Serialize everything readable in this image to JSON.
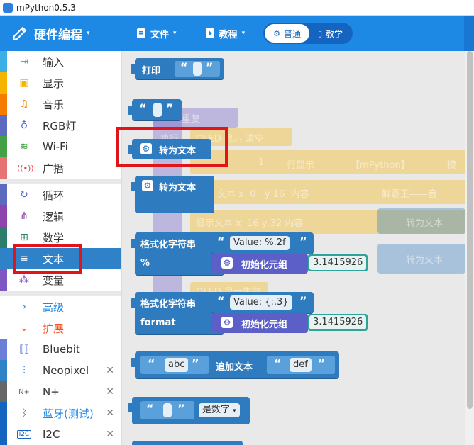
{
  "window": {
    "title": "mPython0.5.3"
  },
  "header": {
    "brand": "硬件编程",
    "menus": [
      {
        "label": "文件"
      },
      {
        "label": "教程"
      }
    ],
    "modes": [
      {
        "label": "普通",
        "active": true
      },
      {
        "label": "教学",
        "active": false
      }
    ]
  },
  "sidebar": {
    "categories": [
      {
        "label": "输入",
        "icon": "input-icon",
        "color": "#3ab0e6"
      },
      {
        "label": "显示",
        "icon": "display-icon",
        "color": "#f5b400"
      },
      {
        "label": "音乐",
        "icon": "music-icon",
        "color": "#f57c00"
      },
      {
        "label": "RGB灯",
        "icon": "bulb-icon",
        "color": "#5c6bc0"
      },
      {
        "label": "Wi-Fi",
        "icon": "wifi-icon",
        "color": "#43a047"
      },
      {
        "label": "广播",
        "icon": "broadcast-icon",
        "color": "#e53935"
      },
      {
        "label": "循环",
        "icon": "loop-icon",
        "color": "#5c6bc0"
      },
      {
        "label": "逻辑",
        "icon": "logic-icon",
        "color": "#8e44ad"
      },
      {
        "label": "数学",
        "icon": "math-icon",
        "color": "#2e7d6b"
      },
      {
        "label": "文本",
        "icon": "text-icon",
        "color": "#2f82c8",
        "active": true
      },
      {
        "label": "变量",
        "icon": "variable-icon",
        "color": "#7e57c2"
      },
      {
        "label": "高级",
        "icon": "chevron-right-icon",
        "color": "#1e88e5"
      },
      {
        "label": "扩展",
        "icon": "chevron-down-icon",
        "color": "#f4511e"
      },
      {
        "label": "Bluebit",
        "icon": "bluebit-icon",
        "color": "#6a7fd6"
      },
      {
        "label": "Neopixel",
        "icon": "neopixel-icon",
        "color": "#2f82c8",
        "closable": true
      },
      {
        "label": "N+",
        "icon": "nplus-icon",
        "color": "#666666",
        "closable": true
      },
      {
        "label": "蓝牙(测试)",
        "icon": "bluetooth-icon",
        "color": "#1565c0",
        "closable": true
      },
      {
        "label": "I2C",
        "icon": "i2c-icon",
        "color": "#1565c0",
        "closable": true
      }
    ]
  },
  "workspace": {
    "print_block": {
      "label": "打印"
    },
    "text_to_string_1": {
      "label": "转为文本"
    },
    "text_to_string_2": {
      "label": "转为文本"
    },
    "format1": {
      "label": "格式化字符串",
      "sub": "%",
      "value": "Value: %.2f",
      "tuple": "初始化元组",
      "num": "3.1415926"
    },
    "format2": {
      "label": "格式化字符串",
      "sub": "format",
      "value": "Value: {:.3}",
      "tuple": "初始化元组",
      "num": "3.1415926"
    },
    "append": {
      "a": "abc",
      "label": "追加文本",
      "b": "def"
    },
    "is_number": {
      "label": "是数字"
    },
    "ghost": {
      "repeat": "重复",
      "exec": "执行",
      "oled": "OLED",
      "show": "显示",
      "clear": "清空",
      "line_num": "1",
      "row_show": "行显示",
      "mpython": "【mPython】",
      "mode": "模",
      "text": "文本",
      "x": "x",
      "x0": "0",
      "y": "y",
      "y16": "16",
      "content": "内容",
      "chn": "鲜霸王——音",
      "show_text": "显示文本",
      "x16": "16",
      "y32": "32",
      "to_text1": "转为文本",
      "to_text2": "转为文本",
      "oled_effect": "OLED 显示生效"
    }
  }
}
